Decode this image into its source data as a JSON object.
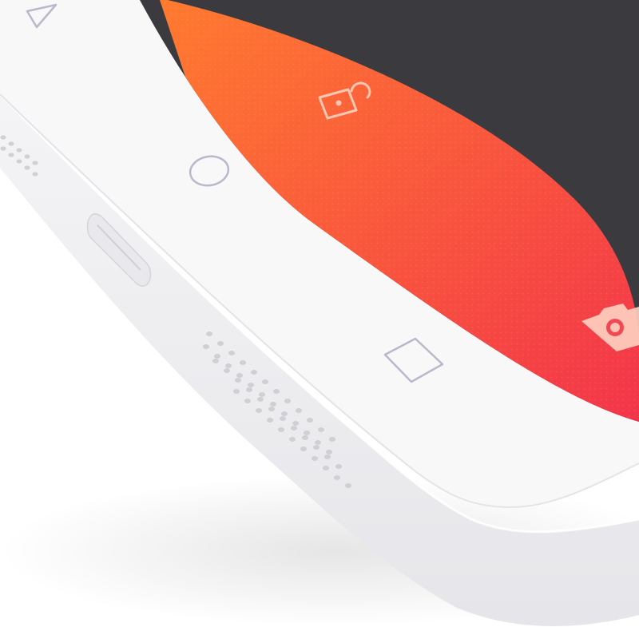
{
  "scene": {
    "subject": "phone-bottom-corner",
    "device_color": "#ffffff",
    "screen_colors": {
      "dark": "#3a3a3f",
      "gradient_top": "#ff7a2f",
      "gradient_bottom": "#f2334b"
    },
    "nav_button_color": "#b9b9cb",
    "screen_icon_color": "#ffd2c2"
  },
  "nav_buttons": [
    {
      "icon": "triangle-back-icon"
    },
    {
      "icon": "circle-home-icon"
    },
    {
      "icon": "square-recents-icon"
    }
  ],
  "screen_icons": [
    {
      "icon": "unlock-icon"
    },
    {
      "icon": "camera-icon"
    }
  ],
  "hardware": [
    {
      "icon": "speaker-grille-left"
    },
    {
      "icon": "usb-port"
    },
    {
      "icon": "speaker-grille-bottom"
    }
  ]
}
